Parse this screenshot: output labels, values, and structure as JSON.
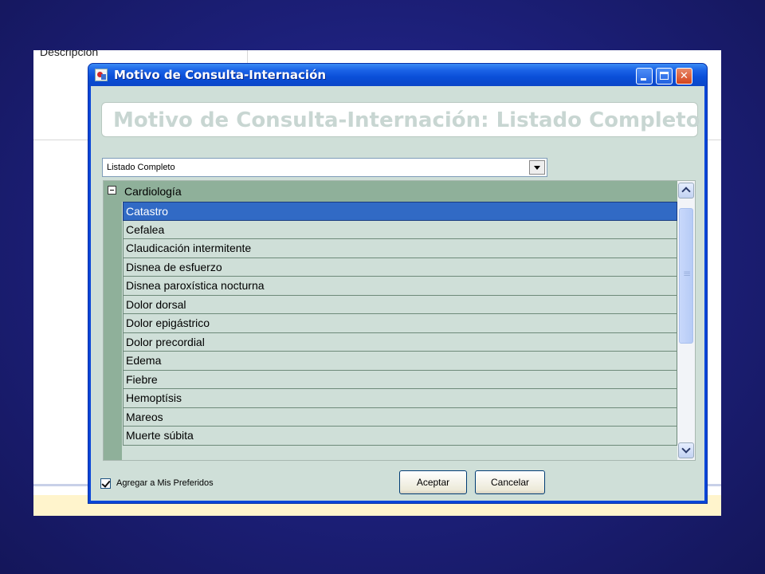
{
  "background": {
    "label": "Descripción"
  },
  "window": {
    "title": "Motivo de Consulta-Internación",
    "header": "Motivo de Consulta-Internación: Listado Completo"
  },
  "filter": {
    "selected": "Listado Completo"
  },
  "tree": {
    "group": "Cardiología",
    "items": [
      "Catastro",
      "Cefalea",
      "Claudicación intermitente",
      "Disnea de esfuerzo",
      "Disnea paroxística nocturna",
      "Dolor dorsal",
      "Dolor epigástrico",
      "Dolor precordial",
      "Edema",
      "Fiebre",
      "Hemoptísis",
      "Mareos",
      "Muerte súbita"
    ],
    "selected_index": 0
  },
  "footer": {
    "favorites_label": "Agregar a Mis Preferidos",
    "favorites_checked": true,
    "accept_label": "Aceptar",
    "cancel_label": "Cancelar"
  },
  "colors": {
    "selection": "#316ac5",
    "titlebar": "#0a4ed8",
    "client": "#cfdfd8"
  }
}
